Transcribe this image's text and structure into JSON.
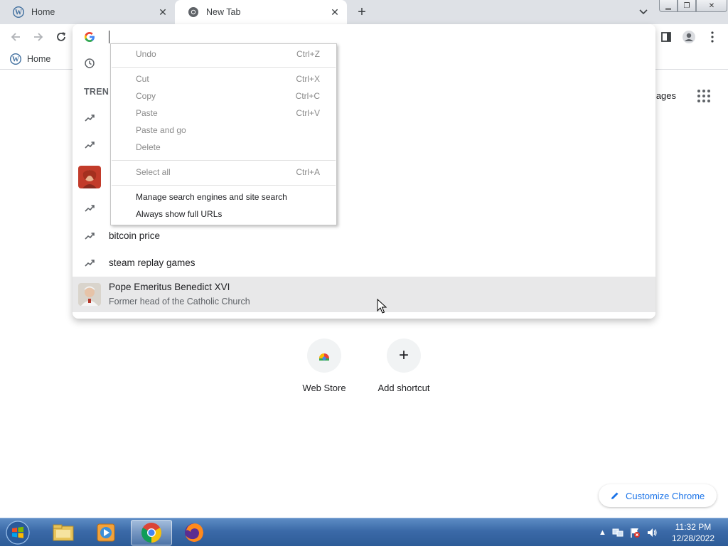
{
  "tabs": [
    {
      "title": "Home",
      "icon": "wordpress-icon",
      "active": false
    },
    {
      "title": "New Tab",
      "icon": "chrome-icon",
      "active": true
    }
  ],
  "bookmarks": [
    {
      "label": "Home",
      "icon": "wordpress-icon"
    }
  ],
  "omnibox": {
    "value": "",
    "trending_header": "TREN",
    "suggestions": [
      {
        "text": "bitcoin price",
        "icon": "trending-icon"
      },
      {
        "text": "steam replay games",
        "icon": "trending-icon"
      }
    ],
    "highlighted": {
      "title": "Pope Emeritus Benedict XVI",
      "subtitle": "Former head of the Catholic Church"
    }
  },
  "context_menu": {
    "items": [
      {
        "label": "Undo",
        "shortcut": "Ctrl+Z",
        "enabled": false
      },
      {
        "label": "Cut",
        "shortcut": "Ctrl+X",
        "enabled": false
      },
      {
        "label": "Copy",
        "shortcut": "Ctrl+C",
        "enabled": false
      },
      {
        "label": "Paste",
        "shortcut": "Ctrl+V",
        "enabled": false
      },
      {
        "label": "Paste and go",
        "shortcut": "",
        "enabled": false
      },
      {
        "label": "Delete",
        "shortcut": "",
        "enabled": false
      },
      {
        "label": "Select all",
        "shortcut": "Ctrl+A",
        "enabled": false
      },
      {
        "label": "Manage search engines and site search",
        "shortcut": "",
        "enabled": true
      },
      {
        "label": "Always show full URLs",
        "shortcut": "",
        "enabled": true
      }
    ]
  },
  "page": {
    "images_link": "mages",
    "shortcuts": [
      {
        "label": "Web Store",
        "icon": "webstore-icon"
      },
      {
        "label": "Add shortcut",
        "icon": "plus-icon"
      }
    ],
    "customize_label": "Customize Chrome"
  },
  "taskbar": {
    "time": "11:32 PM",
    "date": "12/28/2022"
  },
  "colors": {
    "accent": "#1a73e8",
    "tabstrip": "#dee1e6",
    "highlight": "#e8e8e9"
  }
}
